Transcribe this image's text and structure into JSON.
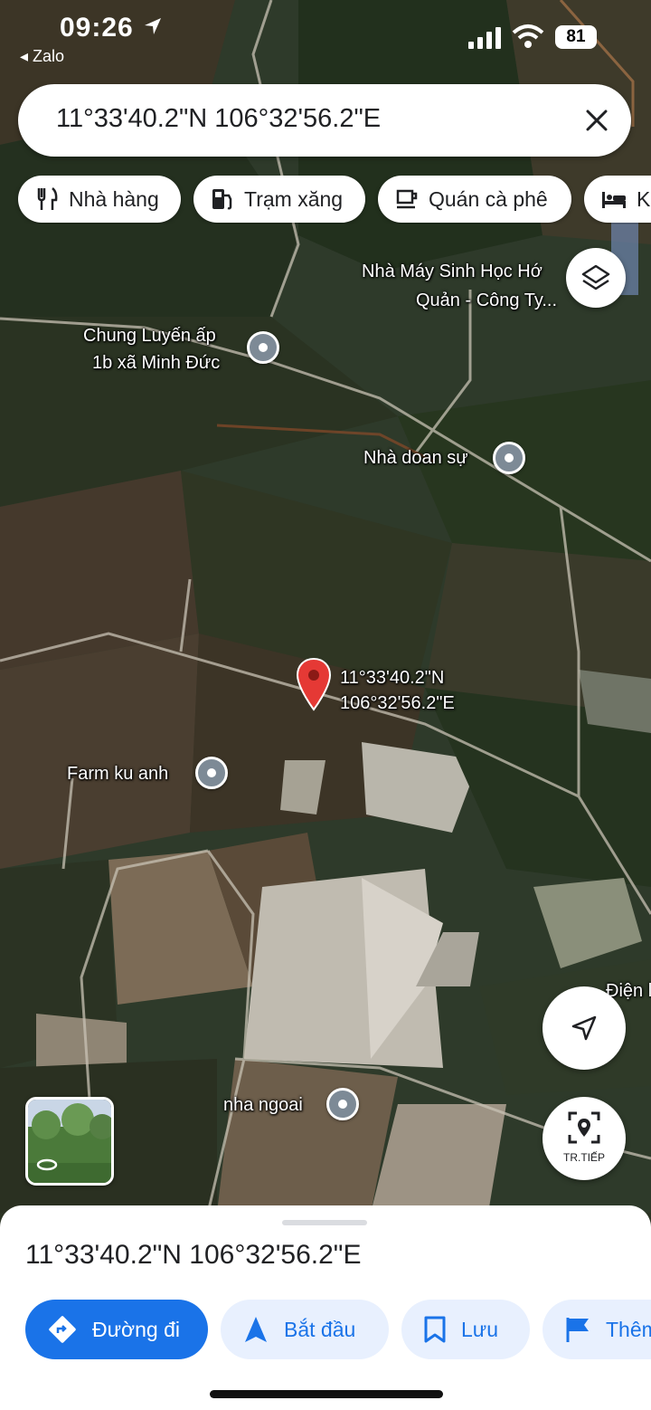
{
  "status_bar": {
    "time": "09:26",
    "back_app": "◂ Zalo",
    "battery": "81"
  },
  "search": {
    "query": "11°33'40.2\"N 106°32'56.2\"E"
  },
  "chips": [
    {
      "label": "Nhà hàng",
      "icon": "fork-knife-icon"
    },
    {
      "label": "Trạm xăng",
      "icon": "gas-station-icon"
    },
    {
      "label": "Quán cà phê",
      "icon": "coffee-cup-icon"
    },
    {
      "label": "Kh",
      "icon": "bed-icon"
    }
  ],
  "map": {
    "places": [
      {
        "line1": "Nhà Máy Sinh Học Hớ",
        "line2": "Quản - Công Ty..."
      },
      {
        "line1": "Chung Luyến ấp",
        "line2": "1b xã Minh Đức"
      },
      {
        "line1": "Nhà doan sự"
      },
      {
        "line1": "Farm ku anh"
      },
      {
        "line1": "Điện lạn"
      },
      {
        "line1": "nha ngoai"
      }
    ],
    "pin": {
      "line1": "11°33'40.2\"N",
      "line2": "106°32'56.2\"E"
    },
    "street_view_label": "TR.TIẾP"
  },
  "sheet": {
    "coords": "11°33'40.2\"N 106°32'56.2\"E",
    "actions": [
      "Đường đi",
      "Bắt đầu",
      "Lưu",
      "Thêm"
    ]
  }
}
